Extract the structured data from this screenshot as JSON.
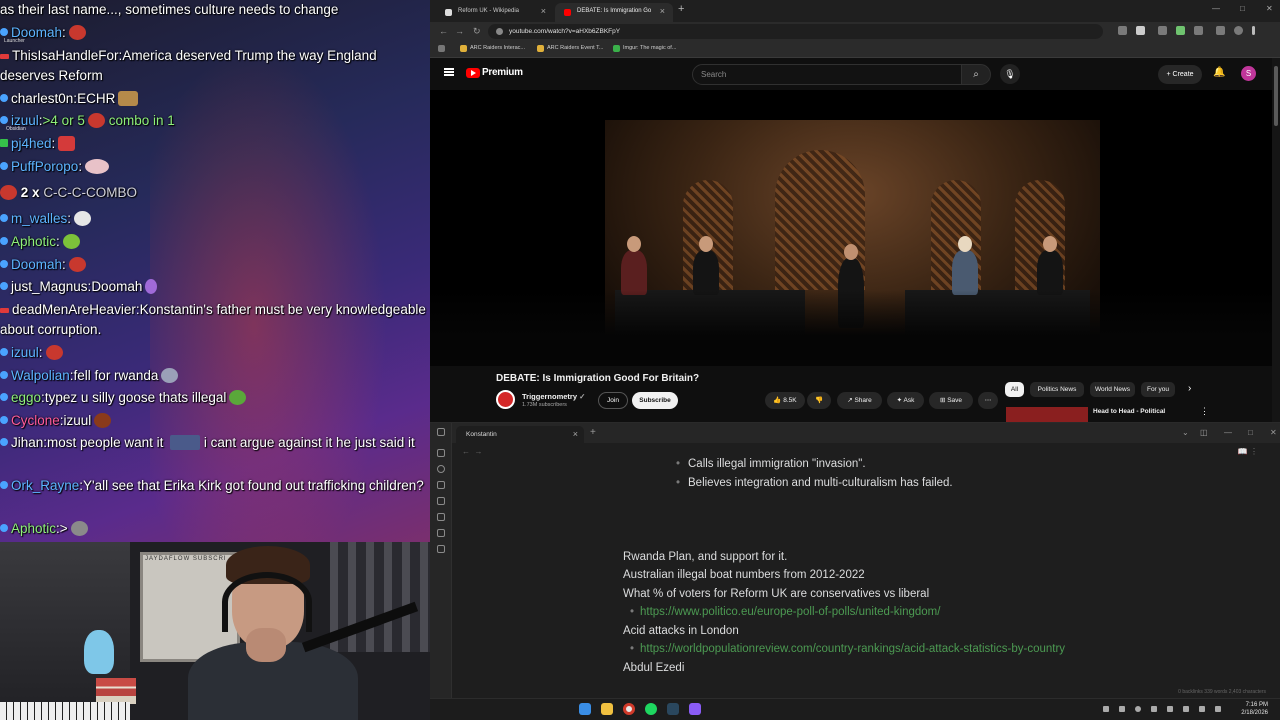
{
  "chat": {
    "messages": [
      {
        "user": "",
        "text": "as their last name..., sometimes culture needs to change",
        "user_color": "#ffffff"
      },
      {
        "user": "Doomah",
        "text": "",
        "user_color": "#5db4ff"
      },
      {
        "user": "ThisIsaHandleFor",
        "text": "America deserved Trump the way England deserves Reform",
        "user_color": "#ffffff"
      },
      {
        "user": "charlest0n",
        "text": "ECHR",
        "user_color": "#ffffff"
      },
      {
        "user": "izuul",
        "text": ">4 or 5",
        "suffix": "combo in 1",
        "user_color": "#5db4ff"
      },
      {
        "user": "pj4hed",
        "text": "",
        "user_color": "#5db4ff"
      },
      {
        "user": "PuffPoropo",
        "text": "",
        "user_color": "#5db4ff"
      },
      {
        "user": "",
        "combo_count": "2 x",
        "text": "C-C-C-COMBO",
        "user_color": "#ffffff"
      },
      {
        "user": "m_walles",
        "text": "",
        "user_color": "#5db4ff"
      },
      {
        "user": "Aphotic",
        "text": "",
        "user_color": "#8ef07a"
      },
      {
        "user": "Doomah",
        "text": "",
        "user_color": "#5db4ff"
      },
      {
        "user": "just_Magnus",
        "text": "Doomah",
        "user_color": "#ffffff"
      },
      {
        "user": "deadMenAreHeavier",
        "text": "Konstantin's father must be very knowledgeable about corruption.",
        "user_color": "#ffffff"
      },
      {
        "user": "izuul",
        "text": "",
        "user_color": "#5db4ff"
      },
      {
        "user": "Walpolian",
        "text": "fell for rwanda",
        "user_color": "#5db4ff"
      },
      {
        "user": "eggo",
        "text": "typez u silly goose thats illegal",
        "user_color": "#8ef07a"
      },
      {
        "user": "Cyclone",
        "text": "izuul",
        "user_color": "#ff5b9a"
      },
      {
        "user": "Jihan",
        "text": "most people want it",
        "suffix": "i cant argue against it he just said it",
        "user_color": "#ffffff"
      },
      {
        "user": "Ork_Rayne",
        "text": "Y'all see that Erika Kirk got found out trafficking children?",
        "user_color": "#5db4ff"
      },
      {
        "user": "Aphotic",
        "text": ">",
        "user_color": "#8ef07a"
      }
    ],
    "side_labels": [
      "Launcher",
      "Obsidian"
    ]
  },
  "webcam": {
    "board_text": "JAYDAFLOW SUBSCRI"
  },
  "browser": {
    "tabs": [
      {
        "label": "Reform UK - Wikipedia",
        "active": false
      },
      {
        "label": "DEBATE: Is Immigration Go",
        "active": true
      }
    ],
    "url": "youtube.com/watch?v=aHXb6ZBKFpY",
    "bookmarks": [
      "ARC Raiders Interac...",
      "ARC Raiders Event T...",
      "Imgur: The magic of..."
    ]
  },
  "youtube": {
    "brand": "Premium",
    "search_placeholder": "Search",
    "create_label": "Create",
    "avatar_letter": "S",
    "video_title": "DEBATE: Is Immigration Good For Britain?",
    "channel_name": "Triggernometry",
    "channel_verified": "✓",
    "subscribers": "1.73M subscribers",
    "join_label": "Join",
    "subscribe_label": "Subscribe",
    "like_count": "8.5K",
    "share_label": "Share",
    "ask_label": "Ask",
    "save_label": "Save",
    "chips": [
      "All",
      "Politics News",
      "World News",
      "For you"
    ],
    "rec_title": "Head to Head - Political"
  },
  "notes": {
    "tab_title": "Konstantin",
    "lines": [
      {
        "type": "bullet",
        "text": "Calls illegal immigration \"invasion\"."
      },
      {
        "type": "bullet",
        "text": "Believes integration and multi-culturalism has failed."
      },
      {
        "type": "spacer",
        "text": ""
      },
      {
        "type": "spacer",
        "text": ""
      },
      {
        "type": "spacer",
        "text": ""
      },
      {
        "type": "text",
        "text": "Rwanda Plan, and support for it."
      },
      {
        "type": "text",
        "text": "Australian illegal boat numbers from 2012-2022"
      },
      {
        "type": "text",
        "text": "What % of voters for Reform UK are conservatives vs liberal"
      },
      {
        "type": "link",
        "text": "https://www.politico.eu/europe-poll-of-polls/united-kingdom/"
      },
      {
        "type": "text",
        "text": "Acid attacks in London"
      },
      {
        "type": "link",
        "text": "https://worldpopulationreview.com/country-rankings/acid-attack-statistics-by-country"
      },
      {
        "type": "text",
        "text": "Abdul Ezedi"
      }
    ],
    "status": "0 backlinks   339 words   2,403 characters"
  },
  "taskbar": {
    "time": "7:16 PM",
    "date": "2/18/2026"
  },
  "colors": {
    "youtube_red": "#ff0000",
    "link_green": "#4c9a52",
    "chat_blue": "#5db4ff"
  }
}
